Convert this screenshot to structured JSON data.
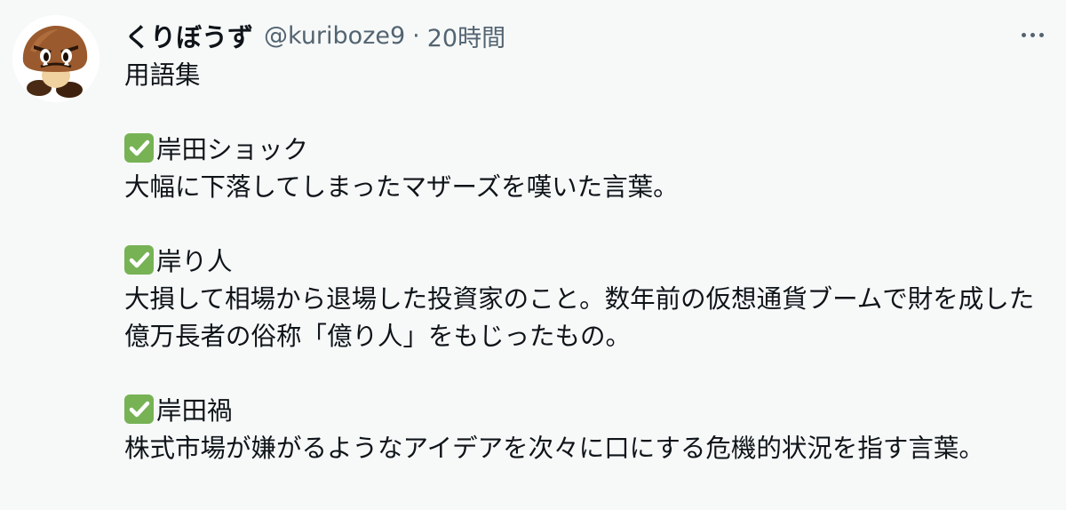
{
  "author": {
    "display_name": "くりぼうず",
    "handle": "@kuriboze9",
    "separator": "·",
    "time": "20時間",
    "avatar_icon": "goomba-avatar-icon"
  },
  "menu": {
    "icon": "more-options-icon"
  },
  "tweet": {
    "title": "用語集",
    "entries": [
      {
        "term": "岸田ショック",
        "definition": "大幅に下落してしまったマザーズを嘆いた言葉。"
      },
      {
        "term": "岸り人",
        "definition": "大損して相場から退場した投資家のこと。数年前の仮想通貨ブームで財を成した億万長者の俗称「億り人」をもじったもの。"
      },
      {
        "term": "岸田禍",
        "definition": "株式市場が嫌がるようなアイデアを次々に口にする危機的状況を指す言葉。"
      }
    ],
    "check_icon": "check-mark-button-icon",
    "colors": {
      "check": "#77b255",
      "text": "#0f1419",
      "secondary": "#536471",
      "background": "#f7f9f9"
    }
  }
}
